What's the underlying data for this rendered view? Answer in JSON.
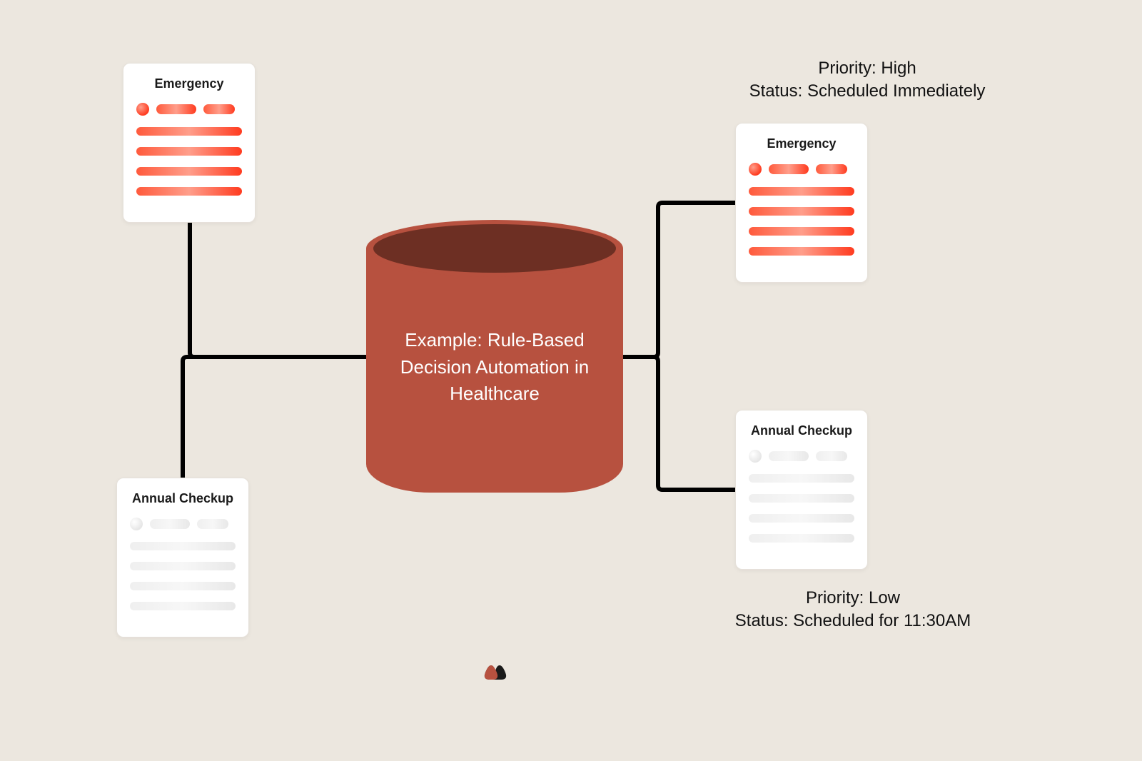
{
  "cylinder": {
    "label": "Example: Rule-Based Decision Automation in Healthcare"
  },
  "inputs": {
    "emergency": {
      "title": "Emergency"
    },
    "checkup": {
      "title": "Annual Checkup"
    }
  },
  "outputs": {
    "emergency": {
      "title": "Emergency",
      "priority_label": "Priority:",
      "priority_value": "High",
      "status_label": "Status:",
      "status_value": "Scheduled Immediately"
    },
    "checkup": {
      "title": "Annual Checkup",
      "priority_label": "Priority:",
      "priority_value": "Low",
      "status_label": "Status:",
      "status_value": "Scheduled for 11:30AM"
    }
  }
}
